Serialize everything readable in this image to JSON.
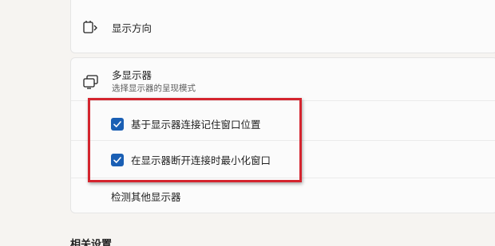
{
  "display_orientation": {
    "label": "显示方向",
    "icon": "display-orientation-icon"
  },
  "multiple_displays": {
    "title": "多显示器",
    "subtitle": "选择显示器的呈现模式",
    "icon": "multiple-displays-icon",
    "options": [
      {
        "label": "基于显示器连接记住窗口位置",
        "checked": true
      },
      {
        "label": "在显示器断开连接时最小化窗口",
        "checked": true
      }
    ],
    "detect_label": "检测其他显示器"
  },
  "related_settings": {
    "title": "相关设置"
  },
  "colors": {
    "accent": "#1a5fb4",
    "highlight": "#d4242e"
  }
}
